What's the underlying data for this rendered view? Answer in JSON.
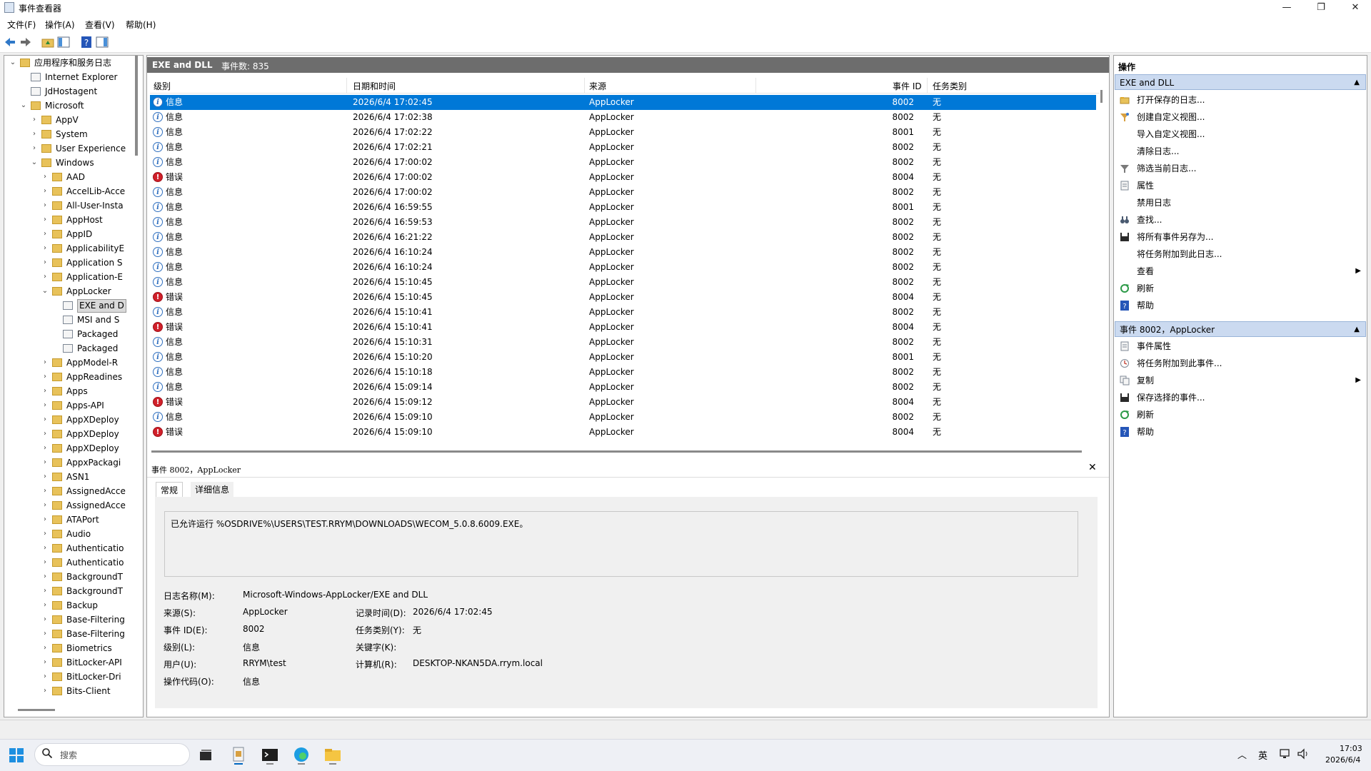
{
  "window": {
    "title": "事件查看器"
  },
  "menu": [
    "文件(F)",
    "操作(A)",
    "查看(V)",
    "帮助(H)"
  ],
  "tree": [
    {
      "label": "应用程序和服务日志",
      "level": 0,
      "expand": "open",
      "icon": "folder"
    },
    {
      "label": "Internet Explorer",
      "level": 1,
      "expand": "",
      "icon": "log"
    },
    {
      "label": "JdHostagent",
      "level": 1,
      "expand": "",
      "icon": "log"
    },
    {
      "label": "Microsoft",
      "level": 1,
      "expand": "open",
      "icon": "folder"
    },
    {
      "label": "AppV",
      "level": 2,
      "expand": "closed",
      "icon": "folder"
    },
    {
      "label": "System",
      "level": 2,
      "expand": "closed",
      "icon": "folder"
    },
    {
      "label": "User Experience",
      "level": 2,
      "expand": "closed",
      "icon": "folder"
    },
    {
      "label": "Windows",
      "level": 2,
      "expand": "open",
      "icon": "folder"
    },
    {
      "label": "AAD",
      "level": 3,
      "expand": "closed",
      "icon": "folder"
    },
    {
      "label": "AccelLib-Acce",
      "level": 3,
      "expand": "closed",
      "icon": "folder"
    },
    {
      "label": "All-User-Insta",
      "level": 3,
      "expand": "closed",
      "icon": "folder"
    },
    {
      "label": "AppHost",
      "level": 3,
      "expand": "closed",
      "icon": "folder"
    },
    {
      "label": "AppID",
      "level": 3,
      "expand": "closed",
      "icon": "folder"
    },
    {
      "label": "ApplicabilityE",
      "level": 3,
      "expand": "closed",
      "icon": "folder"
    },
    {
      "label": "Application S",
      "level": 3,
      "expand": "closed",
      "icon": "folder"
    },
    {
      "label": "Application-E",
      "level": 3,
      "expand": "closed",
      "icon": "folder"
    },
    {
      "label": "AppLocker",
      "level": 3,
      "expand": "open",
      "icon": "folder"
    },
    {
      "label": "EXE and D",
      "level": 4,
      "expand": "",
      "icon": "log",
      "selected": true
    },
    {
      "label": "MSI and S",
      "level": 4,
      "expand": "",
      "icon": "log"
    },
    {
      "label": "Packaged",
      "level": 4,
      "expand": "",
      "icon": "log"
    },
    {
      "label": "Packaged",
      "level": 4,
      "expand": "",
      "icon": "log"
    },
    {
      "label": "AppModel-R",
      "level": 3,
      "expand": "closed",
      "icon": "folder"
    },
    {
      "label": "AppReadines",
      "level": 3,
      "expand": "closed",
      "icon": "folder"
    },
    {
      "label": "Apps",
      "level": 3,
      "expand": "closed",
      "icon": "folder"
    },
    {
      "label": "Apps-API",
      "level": 3,
      "expand": "closed",
      "icon": "folder"
    },
    {
      "label": "AppXDeploy",
      "level": 3,
      "expand": "closed",
      "icon": "folder"
    },
    {
      "label": "AppXDeploy",
      "level": 3,
      "expand": "closed",
      "icon": "folder"
    },
    {
      "label": "AppXDeploy",
      "level": 3,
      "expand": "closed",
      "icon": "folder"
    },
    {
      "label": "AppxPackagi",
      "level": 3,
      "expand": "closed",
      "icon": "folder"
    },
    {
      "label": "ASN1",
      "level": 3,
      "expand": "closed",
      "icon": "folder"
    },
    {
      "label": "AssignedAcce",
      "level": 3,
      "expand": "closed",
      "icon": "folder"
    },
    {
      "label": "AssignedAcce",
      "level": 3,
      "expand": "closed",
      "icon": "folder"
    },
    {
      "label": "ATAPort",
      "level": 3,
      "expand": "closed",
      "icon": "folder"
    },
    {
      "label": "Audio",
      "level": 3,
      "expand": "closed",
      "icon": "folder"
    },
    {
      "label": "Authenticatio",
      "level": 3,
      "expand": "closed",
      "icon": "folder"
    },
    {
      "label": "Authenticatio",
      "level": 3,
      "expand": "closed",
      "icon": "folder"
    },
    {
      "label": "BackgroundT",
      "level": 3,
      "expand": "closed",
      "icon": "folder"
    },
    {
      "label": "BackgroundT",
      "level": 3,
      "expand": "closed",
      "icon": "folder"
    },
    {
      "label": "Backup",
      "level": 3,
      "expand": "closed",
      "icon": "folder"
    },
    {
      "label": "Base-Filtering",
      "level": 3,
      "expand": "closed",
      "icon": "folder"
    },
    {
      "label": "Base-Filtering",
      "level": 3,
      "expand": "closed",
      "icon": "folder"
    },
    {
      "label": "Biometrics",
      "level": 3,
      "expand": "closed",
      "icon": "folder"
    },
    {
      "label": "BitLocker-API",
      "level": 3,
      "expand": "closed",
      "icon": "folder"
    },
    {
      "label": "BitLocker-Dri",
      "level": 3,
      "expand": "closed",
      "icon": "folder"
    },
    {
      "label": "Bits-Client",
      "level": 3,
      "expand": "closed",
      "icon": "folder"
    }
  ],
  "list": {
    "log_name": "EXE and DLL",
    "count_label": "事件数: 835",
    "columns": [
      "级别",
      "日期和时间",
      "来源",
      "事件 ID",
      "任务类别"
    ],
    "rows": [
      {
        "level": "信息",
        "type": "info",
        "datetime": "2026/6/4 17:02:45",
        "source": "AppLocker",
        "id": "8002",
        "task": "无",
        "selected": true
      },
      {
        "level": "信息",
        "type": "info",
        "datetime": "2026/6/4 17:02:38",
        "source": "AppLocker",
        "id": "8002",
        "task": "无"
      },
      {
        "level": "信息",
        "type": "info",
        "datetime": "2026/6/4 17:02:22",
        "source": "AppLocker",
        "id": "8001",
        "task": "无"
      },
      {
        "level": "信息",
        "type": "info",
        "datetime": "2026/6/4 17:02:21",
        "source": "AppLocker",
        "id": "8002",
        "task": "无"
      },
      {
        "level": "信息",
        "type": "info",
        "datetime": "2026/6/4 17:00:02",
        "source": "AppLocker",
        "id": "8002",
        "task": "无"
      },
      {
        "level": "错误",
        "type": "error",
        "datetime": "2026/6/4 17:00:02",
        "source": "AppLocker",
        "id": "8004",
        "task": "无"
      },
      {
        "level": "信息",
        "type": "info",
        "datetime": "2026/6/4 17:00:02",
        "source": "AppLocker",
        "id": "8002",
        "task": "无"
      },
      {
        "level": "信息",
        "type": "info",
        "datetime": "2026/6/4 16:59:55",
        "source": "AppLocker",
        "id": "8001",
        "task": "无"
      },
      {
        "level": "信息",
        "type": "info",
        "datetime": "2026/6/4 16:59:53",
        "source": "AppLocker",
        "id": "8002",
        "task": "无"
      },
      {
        "level": "信息",
        "type": "info",
        "datetime": "2026/6/4 16:21:22",
        "source": "AppLocker",
        "id": "8002",
        "task": "无"
      },
      {
        "level": "信息",
        "type": "info",
        "datetime": "2026/6/4 16:10:24",
        "source": "AppLocker",
        "id": "8002",
        "task": "无"
      },
      {
        "level": "信息",
        "type": "info",
        "datetime": "2026/6/4 16:10:24",
        "source": "AppLocker",
        "id": "8002",
        "task": "无"
      },
      {
        "level": "信息",
        "type": "info",
        "datetime": "2026/6/4 15:10:45",
        "source": "AppLocker",
        "id": "8002",
        "task": "无"
      },
      {
        "level": "错误",
        "type": "error",
        "datetime": "2026/6/4 15:10:45",
        "source": "AppLocker",
        "id": "8004",
        "task": "无"
      },
      {
        "level": "信息",
        "type": "info",
        "datetime": "2026/6/4 15:10:41",
        "source": "AppLocker",
        "id": "8002",
        "task": "无"
      },
      {
        "level": "错误",
        "type": "error",
        "datetime": "2026/6/4 15:10:41",
        "source": "AppLocker",
        "id": "8004",
        "task": "无"
      },
      {
        "level": "信息",
        "type": "info",
        "datetime": "2026/6/4 15:10:31",
        "source": "AppLocker",
        "id": "8002",
        "task": "无"
      },
      {
        "level": "信息",
        "type": "info",
        "datetime": "2026/6/4 15:10:20",
        "source": "AppLocker",
        "id": "8001",
        "task": "无"
      },
      {
        "level": "信息",
        "type": "info",
        "datetime": "2026/6/4 15:10:18",
        "source": "AppLocker",
        "id": "8002",
        "task": "无"
      },
      {
        "level": "信息",
        "type": "info",
        "datetime": "2026/6/4 15:09:14",
        "source": "AppLocker",
        "id": "8002",
        "task": "无"
      },
      {
        "level": "错误",
        "type": "error",
        "datetime": "2026/6/4 15:09:12",
        "source": "AppLocker",
        "id": "8004",
        "task": "无"
      },
      {
        "level": "信息",
        "type": "info",
        "datetime": "2026/6/4 15:09:10",
        "source": "AppLocker",
        "id": "8002",
        "task": "无"
      },
      {
        "level": "错误",
        "type": "error",
        "datetime": "2026/6/4 15:09:10",
        "source": "AppLocker",
        "id": "8004",
        "task": "无"
      }
    ]
  },
  "detail": {
    "title": "事件 8002，AppLocker",
    "tabs": [
      "常规",
      "详细信息"
    ],
    "description": "已允许运行 %OSDRIVE%\\USERS\\TEST.RRYM\\DOWNLOADS\\WECOM_5.0.8.6009.EXE。",
    "fields": {
      "log_name_label": "日志名称(M):",
      "log_name": "Microsoft-Windows-AppLocker/EXE and DLL",
      "source_label": "来源(S):",
      "source": "AppLocker",
      "logged_label": "记录时间(D):",
      "logged": "2026/6/4 17:02:45",
      "event_id_label": "事件 ID(E):",
      "event_id": "8002",
      "task_label": "任务类别(Y):",
      "task": "无",
      "level_label": "级别(L):",
      "level": "信息",
      "keywords_label": "关键字(K):",
      "user_label": "用户(U):",
      "user": "RRYM\\test",
      "computer_label": "计算机(R):",
      "computer": "DESKTOP-NKAN5DA.rrym.local",
      "opcode_label": "操作代码(O):",
      "opcode": "信息"
    }
  },
  "actions": {
    "title": "操作",
    "section1": {
      "title": "EXE and DLL",
      "items": [
        {
          "label": "打开保存的日志...",
          "icon": "folder-open-icon"
        },
        {
          "label": "创建自定义视图...",
          "icon": "funnel-star-icon"
        },
        {
          "label": "导入自定义视图...",
          "icon": ""
        },
        {
          "label": "清除日志...",
          "icon": ""
        },
        {
          "label": "筛选当前日志...",
          "icon": "funnel-icon"
        },
        {
          "label": "属性",
          "icon": "properties-icon"
        },
        {
          "label": "禁用日志",
          "icon": ""
        },
        {
          "label": "查找...",
          "icon": "binoculars-icon"
        },
        {
          "label": "将所有事件另存为...",
          "icon": "save-icon"
        },
        {
          "label": "将任务附加到此日志...",
          "icon": ""
        },
        {
          "label": "查看",
          "icon": "",
          "submenu": true
        },
        {
          "label": "刷新",
          "icon": "refresh-icon"
        },
        {
          "label": "帮助",
          "icon": "help-icon"
        }
      ]
    },
    "section2": {
      "title": "事件 8002，AppLocker",
      "items": [
        {
          "label": "事件属性",
          "icon": "properties-icon"
        },
        {
          "label": "将任务附加到此事件...",
          "icon": "task-icon"
        },
        {
          "label": "复制",
          "icon": "copy-icon",
          "submenu": true
        },
        {
          "label": "保存选择的事件...",
          "icon": "save-icon"
        },
        {
          "label": "刷新",
          "icon": "refresh-icon"
        },
        {
          "label": "帮助",
          "icon": "help-icon"
        }
      ]
    }
  },
  "taskbar": {
    "search_placeholder": "搜索",
    "ime": "英",
    "time": "17:03",
    "date": "2026/6/4"
  }
}
